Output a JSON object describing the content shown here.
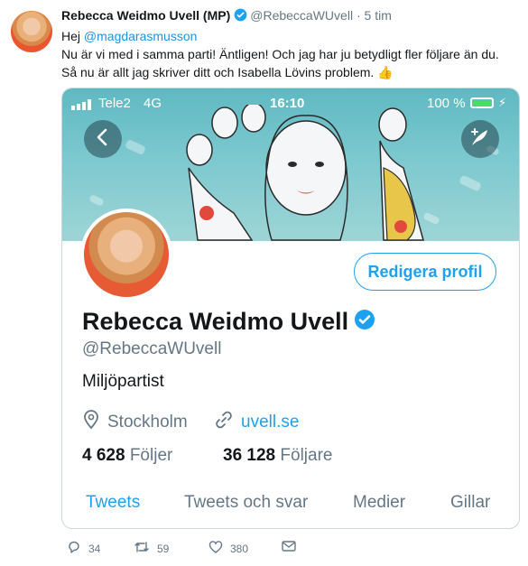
{
  "tweet": {
    "author_name": "Rebecca Weidmo Uvell (MP)",
    "author_handle": "@RebeccaWUvell",
    "separator": "·",
    "time": "5 tim",
    "greeting": "Hej",
    "mention": "@magdarasmusson",
    "line2": "Nu är vi med i samma parti! Äntligen! Och jag har ju betydligt fler följare än du.",
    "line3": "Så nu är allt jag skriver ditt och Isabella Lövins problem.",
    "emoji": "👍",
    "actions": {
      "replies": "34",
      "retweets": "59",
      "likes": "380"
    }
  },
  "phone": {
    "carrier": "Tele2",
    "network": "4G",
    "clock": "16:10",
    "battery_pct": "100 %",
    "battery_level": 1.0,
    "battery_color": "#4cd964"
  },
  "profile": {
    "edit_label": "Redigera profil",
    "name": "Rebecca Weidmo Uvell",
    "handle": "@RebeccaWUvell",
    "bio": "Miljöpartist",
    "location": "Stockholm",
    "url": "uvell.se",
    "following_count": "4 628",
    "following_label": "Följer",
    "followers_count": "36 128",
    "followers_label": "Följare",
    "tabs": [
      {
        "label": "Tweets",
        "active": true
      },
      {
        "label": "Tweets och svar",
        "active": false
      },
      {
        "label": "Medier",
        "active": false
      },
      {
        "label": "Gillar",
        "active": false
      }
    ]
  },
  "colors": {
    "accent": "#1da1f2",
    "mention": "#1b95e0",
    "muted": "#657786",
    "text": "#14171a"
  },
  "icons": [
    "verified-badge-icon",
    "back-chevron-icon",
    "quill-plus-icon",
    "location-pin-icon",
    "link-icon",
    "reply-icon",
    "retweet-icon",
    "heart-icon",
    "envelope-icon",
    "signal-bars-icon",
    "battery-icon"
  ]
}
